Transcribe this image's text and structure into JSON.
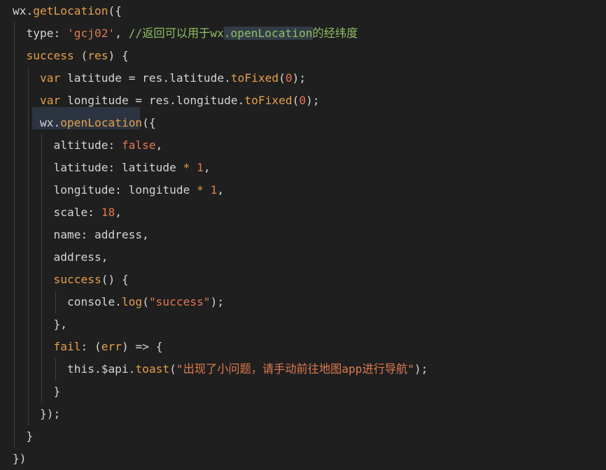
{
  "colors": {
    "background": "#1f1f1f",
    "plain": "#d4d4d4",
    "keyword": "#e5a04a",
    "function": "#e5a04a",
    "string": "#e07a50",
    "number": "#e07a50",
    "comment": "#8fbf62",
    "property": "#d4d4d4",
    "value_var": "#d4d4d4",
    "indent_guide": "#3f3f3f",
    "highlight": "#2b3440"
  },
  "code": {
    "lines": [
      [
        {
          "t": "wx.",
          "c": "plain"
        },
        {
          "t": "getLocation",
          "c": "function"
        },
        {
          "t": "({",
          "c": "plain"
        }
      ],
      [
        {
          "t": "  type: ",
          "c": "plain"
        },
        {
          "t": "'gcj02'",
          "c": "string"
        },
        {
          "t": ", ",
          "c": "plain"
        },
        {
          "t": "//返回可以用于wx",
          "c": "comment"
        },
        {
          "t": ".openLocation",
          "c": "comment",
          "hl": true
        },
        {
          "t": "的经纬度",
          "c": "comment"
        }
      ],
      [
        {
          "t": "  ",
          "c": "plain"
        },
        {
          "t": "success",
          "c": "function"
        },
        {
          "t": " (",
          "c": "plain"
        },
        {
          "t": "res",
          "c": "keyword"
        },
        {
          "t": ") {",
          "c": "plain"
        }
      ],
      [
        {
          "t": "    ",
          "c": "plain"
        },
        {
          "t": "var",
          "c": "keyword"
        },
        {
          "t": " latitude = res.latitude.",
          "c": "plain"
        },
        {
          "t": "toFixed",
          "c": "function"
        },
        {
          "t": "(",
          "c": "plain"
        },
        {
          "t": "0",
          "c": "number"
        },
        {
          "t": ");",
          "c": "plain"
        }
      ],
      [
        {
          "t": "    ",
          "c": "plain"
        },
        {
          "t": "var",
          "c": "keyword"
        },
        {
          "t": " longitude = res.longitude.",
          "c": "plain"
        },
        {
          "t": "toFixed",
          "c": "function"
        },
        {
          "t": "(",
          "c": "plain"
        },
        {
          "t": "0",
          "c": "number"
        },
        {
          "t": ");",
          "c": "plain"
        }
      ],
      [
        {
          "t": "    wx.",
          "c": "plain"
        },
        {
          "t": "openLocation",
          "c": "function"
        },
        {
          "t": "({",
          "c": "plain"
        }
      ],
      [
        {
          "t": "      altitude: ",
          "c": "plain"
        },
        {
          "t": "false",
          "c": "string"
        },
        {
          "t": ",",
          "c": "plain"
        }
      ],
      [
        {
          "t": "      latitude: latitude ",
          "c": "plain"
        },
        {
          "t": "*",
          "c": "keyword"
        },
        {
          "t": " ",
          "c": "plain"
        },
        {
          "t": "1",
          "c": "number"
        },
        {
          "t": ",",
          "c": "plain"
        }
      ],
      [
        {
          "t": "      longitude: longitude ",
          "c": "plain"
        },
        {
          "t": "*",
          "c": "keyword"
        },
        {
          "t": " ",
          "c": "plain"
        },
        {
          "t": "1",
          "c": "number"
        },
        {
          "t": ",",
          "c": "plain"
        }
      ],
      [
        {
          "t": "      scale: ",
          "c": "plain"
        },
        {
          "t": "18",
          "c": "number"
        },
        {
          "t": ",",
          "c": "plain"
        }
      ],
      [
        {
          "t": "      name: address,",
          "c": "plain"
        }
      ],
      [
        {
          "t": "      address,",
          "c": "plain"
        }
      ],
      [
        {
          "t": "      ",
          "c": "plain"
        },
        {
          "t": "success",
          "c": "function"
        },
        {
          "t": "() {",
          "c": "plain"
        }
      ],
      [
        {
          "t": "        console.",
          "c": "plain"
        },
        {
          "t": "log",
          "c": "function"
        },
        {
          "t": "(",
          "c": "plain"
        },
        {
          "t": "\"success\"",
          "c": "string"
        },
        {
          "t": ");",
          "c": "plain"
        }
      ],
      [
        {
          "t": "      },",
          "c": "plain"
        }
      ],
      [
        {
          "t": "      ",
          "c": "plain"
        },
        {
          "t": "fail",
          "c": "function"
        },
        {
          "t": ": (",
          "c": "plain"
        },
        {
          "t": "err",
          "c": "keyword"
        },
        {
          "t": ") => {",
          "c": "plain"
        }
      ],
      [
        {
          "t": "        this.$api.",
          "c": "plain"
        },
        {
          "t": "toast",
          "c": "function"
        },
        {
          "t": "(",
          "c": "plain"
        },
        {
          "t": "\"出现了小问题，请手动前往地图app进行导航\"",
          "c": "string"
        },
        {
          "t": ");",
          "c": "plain"
        }
      ],
      [
        {
          "t": "      }",
          "c": "plain"
        }
      ],
      [
        {
          "t": "    });",
          "c": "plain"
        }
      ],
      [
        {
          "t": "  }",
          "c": "plain"
        }
      ],
      [
        {
          "t": "})",
          "c": "plain"
        }
      ]
    ]
  }
}
